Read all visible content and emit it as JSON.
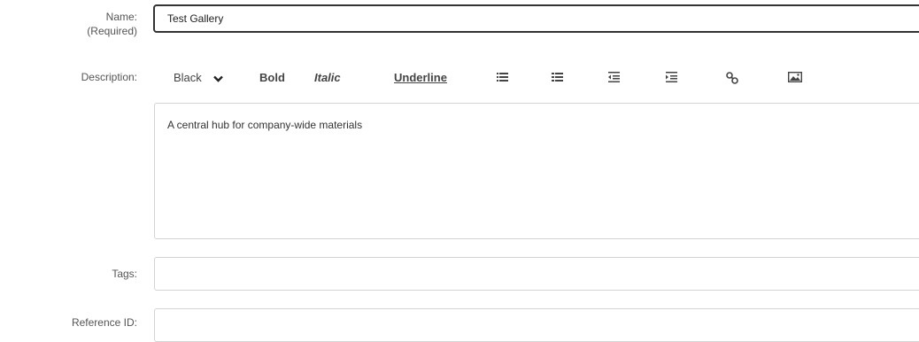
{
  "form": {
    "name": {
      "label": "Name:",
      "sublabel": "(Required)",
      "value": "Test Gallery"
    },
    "description": {
      "label": "Description:",
      "value": "A central hub for company-wide materials",
      "toolbar": {
        "font_color": "Black",
        "bold": "Bold",
        "italic": "Italic",
        "underline": "Underline",
        "icons": [
          "bulleted-list-icon",
          "numbered-list-icon",
          "outdent-icon",
          "indent-icon",
          "link-icon",
          "image-icon"
        ]
      }
    },
    "tags": {
      "label": "Tags:",
      "value": ""
    },
    "reference_id": {
      "label": "Reference ID:",
      "value": ""
    }
  },
  "colors": {
    "field_border": "#d4d4d4",
    "focused_border": "#333333",
    "label_text": "#555555"
  }
}
